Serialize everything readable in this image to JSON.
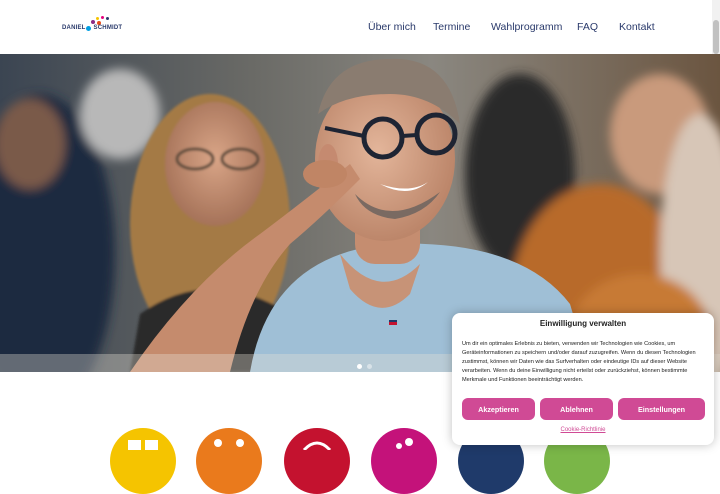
{
  "logo": {
    "first_name": "DANIEL",
    "last_name": "SCHMIDT",
    "dot_colors": [
      "#f5c400",
      "#e5007d",
      "#2a3a6b",
      "#8b2c86",
      "#e94e1b",
      "#009fe3"
    ]
  },
  "nav": {
    "items": [
      {
        "label": "Über mich"
      },
      {
        "label": "Termine"
      },
      {
        "label": "Wahlprogramm"
      },
      {
        "label": "FAQ"
      },
      {
        "label": "Kontakt"
      }
    ]
  },
  "hero": {
    "slide_count": 2,
    "active_slide": 1
  },
  "feature_icons": [
    {
      "icon": "yellow-circle-icon",
      "color": "#f5c400"
    },
    {
      "icon": "orange-circle-icon",
      "color": "#ea7a1c"
    },
    {
      "icon": "red-circle-icon",
      "color": "#c4122f"
    },
    {
      "icon": "magenta-circle-icon",
      "color": "#c4127a"
    },
    {
      "icon": "navy-circle-icon",
      "color": "#1f3a6a"
    },
    {
      "icon": "green-circle-icon",
      "color": "#7ab648"
    }
  ],
  "cookie": {
    "title": "Einwilligung verwalten",
    "text": "Um dir ein optimales Erlebnis zu bieten, verwenden wir Technologien wie Cookies, um Geräteinformationen zu speichern und/oder darauf zuzugreifen. Wenn du diesen Technologien zustimmst, können wir Daten wie das Surfverhalten oder eindeutige IDs auf dieser Website verarbeiten. Wenn du deine Einwilligung nicht erteilst oder zurückziehst, können bestimmte Merkmale und Funktionen beeinträchtigt werden.",
    "accept_label": "Akzeptieren",
    "decline_label": "Ablehnen",
    "settings_label": "Einstellungen ansehen",
    "policy_label": "Cookie-Richtlinie",
    "accent_color": "#d04a95"
  }
}
